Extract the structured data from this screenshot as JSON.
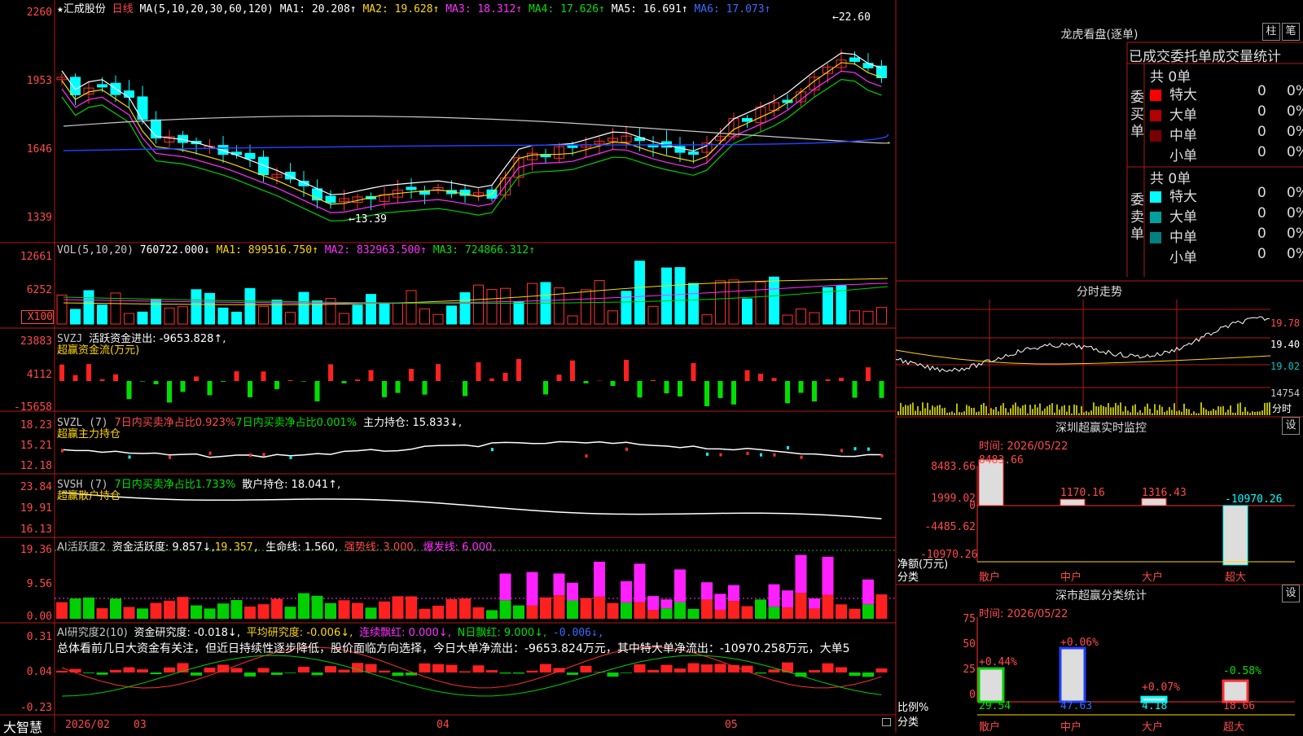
{
  "header": {
    "stock_name": "汇成股份",
    "period": "日线",
    "ma_label": "MA(5,10,20,30,60,120)",
    "ma1": "MA1: 20.208↑",
    "ma2": "MA2: 19.628↑",
    "ma3": "MA3: 18.312↑",
    "ma4": "MA4: 17.626↑",
    "ma5": "MA5: 16.691↑",
    "ma6": "MA6: 17.073↑",
    "high_mark": "22.60",
    "low_mark": "13.39"
  },
  "price_axis": [
    "2260",
    "1953",
    "1646",
    "1339"
  ],
  "vol": {
    "label": "VOL(5,10,20)",
    "value": "760722.000↓",
    "ma1": "MA1: 899516.750↑",
    "ma2": "MA2: 832963.500↑",
    "ma3": "MA3: 724866.312↑",
    "axis": [
      "12661",
      "6252",
      "X100"
    ]
  },
  "svzj": {
    "label": "SVZJ",
    "text": "活跃资金进出: -9653.828↑,",
    "sub": "超赢资金流(万元)",
    "axis": [
      "23883",
      "4112",
      "-15658"
    ]
  },
  "svzl": {
    "label": "SVZL (7)",
    "t1": "7日内买卖净占比0.923%",
    "t2": "7日内买卖净占比0.001%",
    "t3": "主力持仓: 15.833↓,",
    "sub": "超赢主力持仓",
    "axis": [
      "18.23",
      "15.21",
      "12.18"
    ]
  },
  "svsh": {
    "label": "SVSH (7)",
    "t1": "7日内买卖净占比1.733%",
    "t2": "散户持仓: 18.041↑,",
    "sub": "超赢散户持仓",
    "axis": [
      "23.84",
      "19.91",
      "16.13"
    ]
  },
  "ai1": {
    "label": "AI活跃度2",
    "t1": "资金活跃度: 9.857↓,",
    "t2": "19.357,",
    "t3": "生命线: 1.560,",
    "t4": "强势线: 3.000,",
    "t5": "爆发线: 6.000,",
    "axis": [
      "19.36",
      "9.56",
      "0.00"
    ]
  },
  "ai2": {
    "label": "AI研究度2(10)",
    "t1": "资金研究度: -0.018↓,",
    "t2": "平均研究度: -0.006↓,",
    "t3": "连续飘红: 0.000↓,",
    "t4": "N日飘红: 9.000↓,",
    "t5": "-0.006↓,",
    "summary": "总体看前几日大资金有关注，但近日持续性逐步降低，股价面临方向选择，今日大单净流出：-9653.824万元，其中特大单净流出：-10970.258万元，大单5",
    "axis": [
      "0.31",
      "0.04",
      "-0.23"
    ]
  },
  "footer": {
    "brand": "大智慧",
    "d1": "2026/02",
    "d2": "03",
    "d3": "04",
    "d4": "05"
  },
  "right": {
    "longhu_title": "龙虎看盘(逐单)",
    "btn_zhu": "柱",
    "btn_bi": "笔",
    "col_title": "已成交委托单成交量统计",
    "buy_label": "委买单",
    "sell_label": "委卖单",
    "buy_total": "共 0单",
    "sell_total": "共 0单",
    "buy_rows": [
      {
        "name": "特大",
        "n": "0",
        "p": "0%",
        "c": "#ff0000"
      },
      {
        "name": "大单",
        "n": "0",
        "p": "0%",
        "c": "#b00000"
      },
      {
        "name": "中单",
        "n": "0",
        "p": "0%",
        "c": "#7a0000"
      },
      {
        "name": "小单",
        "n": "0",
        "p": "0%",
        "c": "#000000"
      }
    ],
    "sell_rows": [
      {
        "name": "特大",
        "n": "0",
        "p": "0%",
        "c": "#00ffff"
      },
      {
        "name": "大单",
        "n": "0",
        "p": "0%",
        "c": "#00a0a0"
      },
      {
        "name": "中单",
        "n": "0",
        "p": "0%",
        "c": "#008080"
      },
      {
        "name": "小单",
        "n": "0",
        "p": "0%",
        "c": "#000000"
      }
    ],
    "fenshi_title": "分时走势",
    "fenshi_axis": [
      "19.78",
      "19.40",
      "19.02",
      "14754",
      "分时"
    ],
    "sz_title": "深圳超赢实时监控",
    "sz_time": "时间: 2026/05/22",
    "sz_btn": "设",
    "sz_axis": [
      "8483.66",
      "1999.02",
      "0",
      "-4485.62",
      "-10970.26"
    ],
    "sz_ylabel": "净额(万元)",
    "sz_xlabel": "分类",
    "sz_vals": [
      "8483.66",
      "1170.16",
      "1316.43",
      "-10970.26"
    ],
    "cats": [
      "散户",
      "中户",
      "大户",
      "超大"
    ],
    "sm_title": "深市超赢分类统计",
    "sm_time": "时间: 2026/05/22",
    "sm_btn": "设",
    "sm_axis": [
      "75",
      "50",
      "25",
      "0"
    ],
    "sm_ylabel": "比例%",
    "sm_xlabel": "分类",
    "sm_chg": [
      "+0.44%",
      "+0.06%",
      "+0.07%",
      "-0.58%"
    ],
    "sm_vals": [
      "29.54",
      "47.63",
      "4.18",
      "18.66"
    ]
  },
  "chart_data": [
    {
      "type": "bar",
      "title": "深圳超赢实时监控",
      "categories": [
        "散户",
        "中户",
        "大户",
        "超大"
      ],
      "values": [
        8483.66,
        1170.16,
        1316.43,
        -10970.26
      ],
      "ylabel": "净额(万元)",
      "ylim": [
        -10970.26,
        8483.66
      ]
    },
    {
      "type": "bar",
      "title": "深市超赢分类统计",
      "categories": [
        "散户",
        "中户",
        "大户",
        "超大"
      ],
      "values": [
        29.54,
        47.63,
        4.18,
        18.66
      ],
      "ylabel": "比例%",
      "ylim": [
        0,
        75
      ]
    }
  ]
}
